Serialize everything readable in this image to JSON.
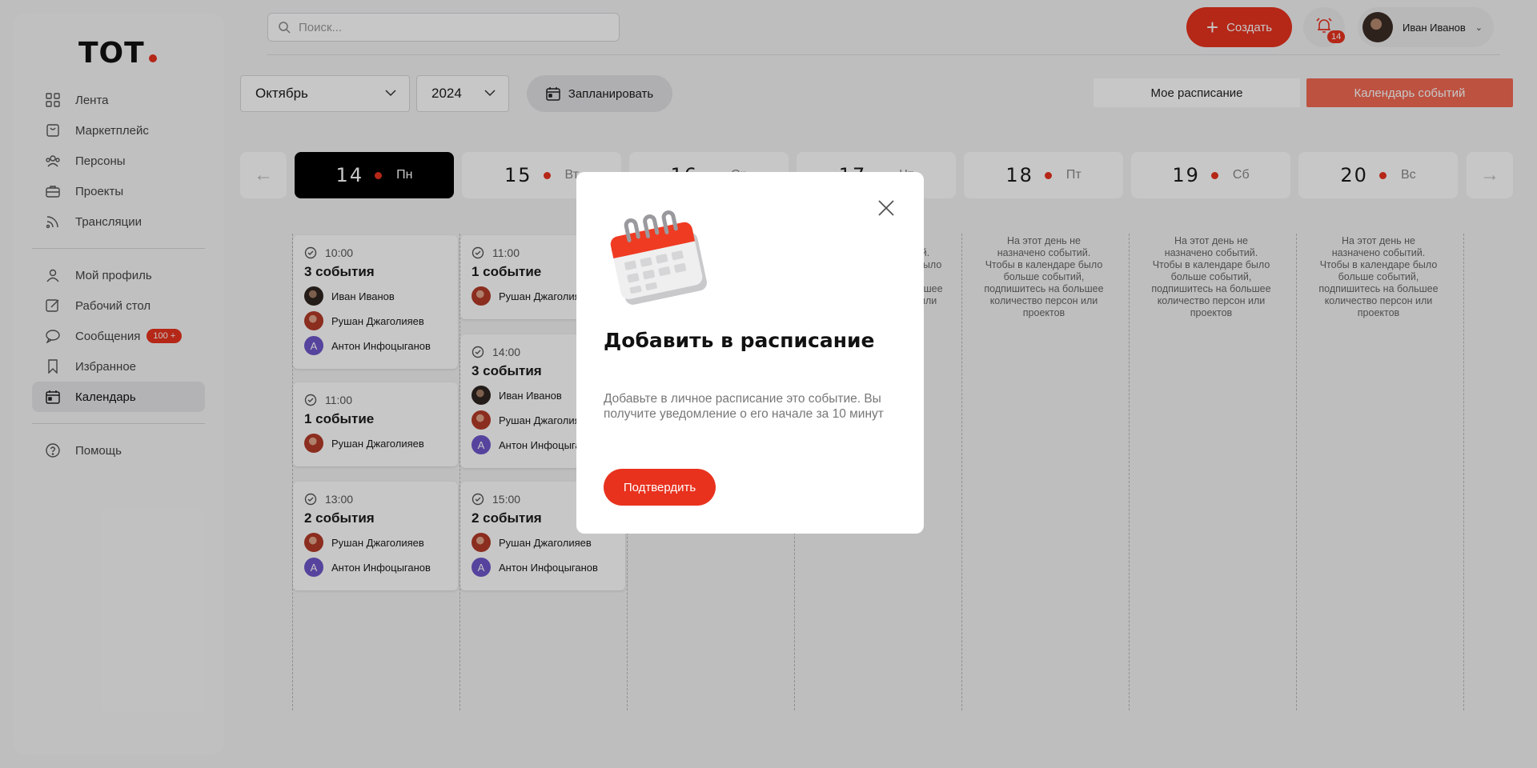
{
  "sidebar": {
    "logo": "ТОТ",
    "items": [
      {
        "label": "Лента",
        "icon": "grid-icon"
      },
      {
        "label": "Маркетплейс",
        "icon": "bag-icon"
      },
      {
        "label": "Персоны",
        "icon": "people-icon"
      },
      {
        "label": "Проекты",
        "icon": "briefcase-icon"
      },
      {
        "label": "Трансляции",
        "icon": "broadcast-icon"
      },
      {
        "label": "Мой профиль",
        "icon": "user-icon"
      },
      {
        "label": "Рабочий стол",
        "icon": "edit-icon"
      },
      {
        "label": "Сообщения",
        "icon": "chat-icon",
        "badge": "100 +"
      },
      {
        "label": "Избранное",
        "icon": "bookmark-icon"
      },
      {
        "label": "Календарь",
        "icon": "calendar-icon",
        "active": true
      },
      {
        "label": "Помощь",
        "icon": "help-icon"
      }
    ]
  },
  "header": {
    "search_placeholder": "Поиск...",
    "create_label": "Создать",
    "notifications_count": "14",
    "user_name": "Иван Иванов"
  },
  "controls": {
    "month": "Октябрь",
    "year": "2024",
    "plan_label": "Запланировать",
    "tab_mine": "Мое расписание",
    "tab_events": "Календарь событий"
  },
  "days": [
    {
      "num": "14",
      "wd": "Пн",
      "active": true
    },
    {
      "num": "15",
      "wd": "Вт"
    },
    {
      "num": "16",
      "wd": "Ср"
    },
    {
      "num": "17",
      "wd": "Чт"
    },
    {
      "num": "18",
      "wd": "Пт"
    },
    {
      "num": "19",
      "wd": "Сб"
    },
    {
      "num": "20",
      "wd": "Вс"
    }
  ],
  "empty_note": "На этот день не назначено событий. Чтобы в календаре было больше событий, подпишитесь на большее количество персон или проектов",
  "events": {
    "col1": [
      {
        "time": "10:00",
        "title": "3 события",
        "people": [
          "Иван Иванов",
          "Рушан Джаголияев",
          "Антон Инфоцыганов"
        ]
      },
      {
        "time": "11:00",
        "title": "1 событие",
        "people": [
          "Рушан Джаголияев"
        ]
      },
      {
        "time": "13:00",
        "title": "2 события",
        "people": [
          "Рушан Джаголияев",
          "Антон Инфоцыганов"
        ]
      }
    ],
    "col2": [
      {
        "time": "11:00",
        "title": "1 событие",
        "people": [
          "Рушан Джаголияев"
        ]
      },
      {
        "time": "14:00",
        "title": "3 события",
        "people": [
          "Иван Иванов",
          "Рушан Джаголияев",
          "Антон Инфоцыганов"
        ]
      },
      {
        "time": "15:00",
        "title": "2 события",
        "people": [
          "Рушан Джаголияев",
          "Антон Инфоцыганов"
        ]
      }
    ]
  },
  "modal": {
    "title": "Добавить в расписание",
    "text": "Добавьте в личное расписание это событие. Вы получите уведомление о его начале за 10 минут",
    "confirm": "Подтвердить"
  }
}
